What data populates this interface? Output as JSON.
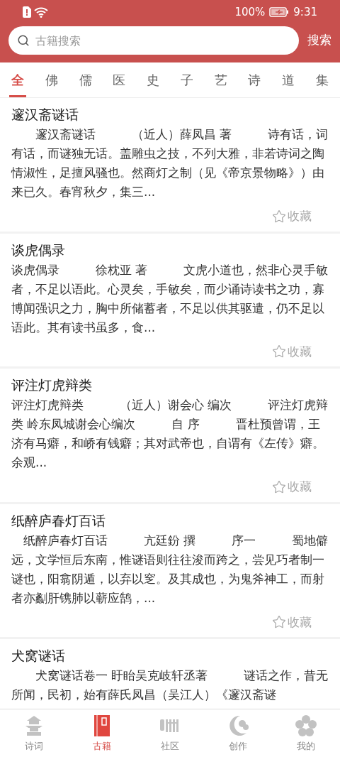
{
  "status_bar": {
    "battery": "100%",
    "time": "9:31"
  },
  "search": {
    "placeholder": "古籍搜索",
    "button": "搜索"
  },
  "tabs": [
    {
      "label": "全",
      "selected": true
    },
    {
      "label": "佛",
      "selected": false
    },
    {
      "label": "儒",
      "selected": false
    },
    {
      "label": "医",
      "selected": false
    },
    {
      "label": "史",
      "selected": false
    },
    {
      "label": "子",
      "selected": false
    },
    {
      "label": "艺",
      "selected": false
    },
    {
      "label": "诗",
      "selected": false
    },
    {
      "label": "道",
      "selected": false
    },
    {
      "label": "集",
      "selected": false
    }
  ],
  "books": [
    {
      "title": "邃汉斋谜话",
      "excerpt": "　　邃汉斋谜话　　　（近人）薛凤昌 著　　　诗有话，词有话，而谜独无话。盖雕虫之技，不列大雅，非若诗词之陶情淑性，足擅风骚也。然商灯之制（见《帝京景物略》）由来已久。春宵秋夕，集三...",
      "favorite": {
        "label": "收藏",
        "selected": false
      }
    },
    {
      "title": "谈虎偶录",
      "excerpt": "谈虎偶录　　　徐枕亚 著　　　文虎小道也，然非心灵手敏者，不足以语此。心灵矣，手敏矣，而少诵诗读书之功，寡博闻强识之力，胸中所储蓄者，不足以供其驱遣，仍不足以语此。其有读书虽多，食...",
      "favorite": {
        "label": "收藏",
        "selected": false
      }
    },
    {
      "title": "评注灯虎辩类",
      "excerpt": "评注灯虎辩类　　　（近人）谢会心 编次　　　评注灯虎辩类 岭东凤城谢会心编次　　　自 序　　　晋杜预曾谓，王济有马癖，和峤有钱癖；其对武帝也，自谓有《左传》癖。余观...",
      "favorite": {
        "label": "收藏",
        "selected": false
      }
    },
    {
      "title": "纸醉庐春灯百话",
      "excerpt": "　纸醉庐春灯百话　　　亢廷鈖 撰　　　序一　　　蜀地僻远，文学恒后东南，惟谜语则往往浚而跨之，尝见巧者制一谜也，阳翕阴遁，以弃以窆。及其成也，为鬼斧神工，而射者亦劙肝镌肺以蕲应鹄，...",
      "favorite": {
        "label": "收藏",
        "selected": false
      }
    },
    {
      "title": "犬窝谜话",
      "excerpt": "　　犬窝谜话卷一 盱眙吴克岐轩丞著　　　谜话之作，昔无所闻，民初，始有薛氏凤昌（吴江人）《邃汉斋谜"
    }
  ],
  "nav": [
    {
      "label": "诗词",
      "kind": "pagoda",
      "selected": false
    },
    {
      "label": "古籍",
      "kind": "book",
      "selected": true
    },
    {
      "label": "社区",
      "kind": "scroll",
      "selected": false
    },
    {
      "label": "创作",
      "kind": "cloud",
      "selected": false
    },
    {
      "label": "我的",
      "kind": "flower",
      "selected": false
    }
  ]
}
